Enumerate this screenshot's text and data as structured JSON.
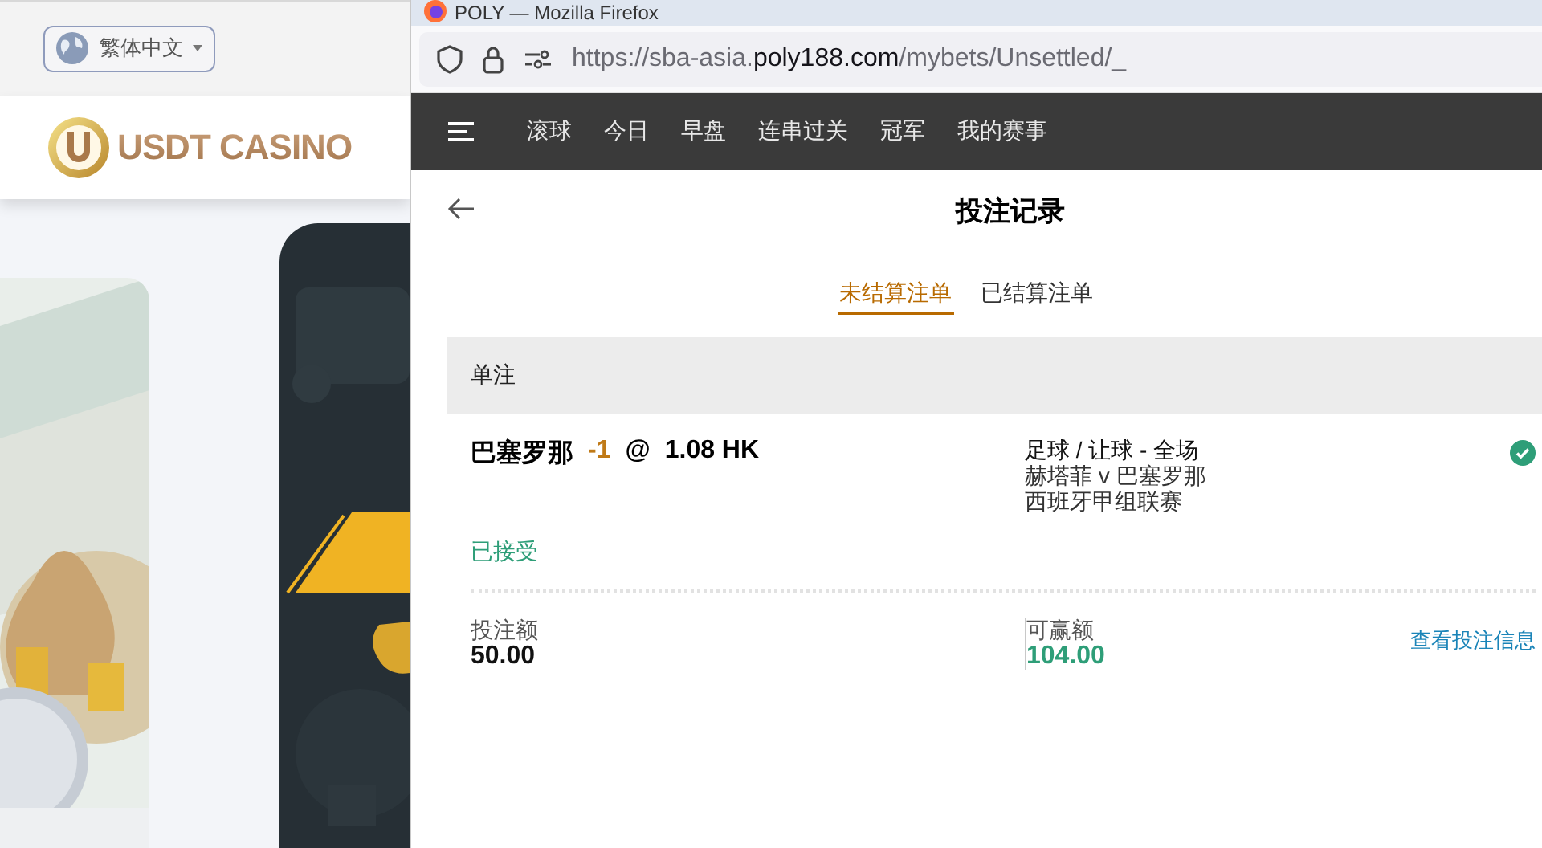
{
  "background_page": {
    "language": "繁体中文",
    "logo": "USDT CASINO"
  },
  "window": {
    "title": "POLY — Mozilla Firefox",
    "url": {
      "prefix": "https://sba-asia.",
      "domain": "poly188.com",
      "path": "/mybets/Unsettled/_"
    }
  },
  "nav": {
    "items": [
      "滚球",
      "今日",
      "早盘",
      "连串过关",
      "冠军",
      "我的赛事"
    ]
  },
  "page": {
    "title": "投注记录",
    "tabs": [
      {
        "label": "未结算注单",
        "selected": true
      },
      {
        "label": "已结算注单",
        "selected": false
      }
    ]
  },
  "section": {
    "title": "单注"
  },
  "bet": {
    "selection": "巴塞罗那",
    "handicap": "-1",
    "at": "@",
    "odds": "1.08 HK",
    "market": "足球 / 让球 - 全场",
    "match": "赫塔菲 v 巴塞罗那",
    "league": "西班牙甲组联赛",
    "accepted": true,
    "status": "已接受",
    "stake_label": "投注额",
    "stake": "50.00",
    "win_label": "可赢额",
    "win": "104.00",
    "details_link": "查看投注信息"
  }
}
